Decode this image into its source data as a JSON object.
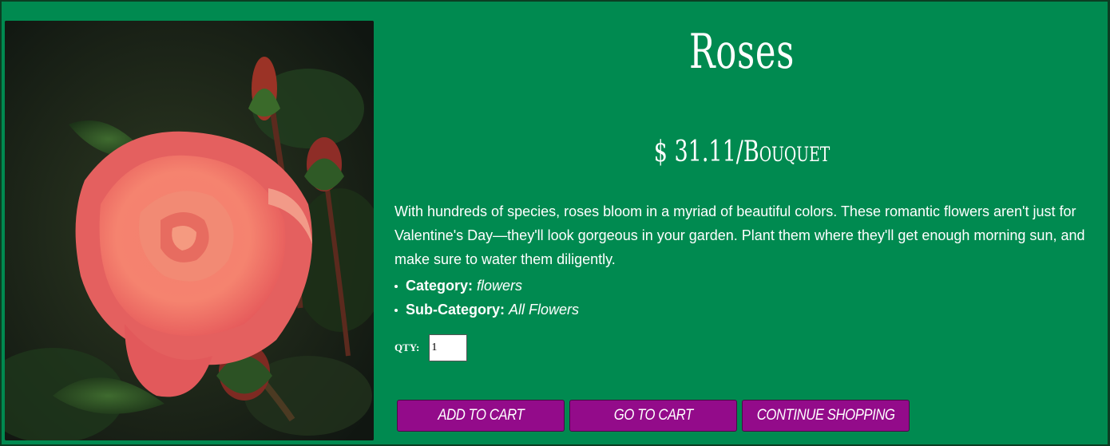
{
  "product": {
    "title": "Roses",
    "price": "$ 31.11/Bouquet",
    "description": "With hundreds of species, roses bloom in a myriad of beautiful colors. These romantic flowers aren't just for Valentine's Day—they'll look gorgeous in your garden. Plant them where they'll get enough morning sun, and make sure to water them diligently.",
    "image_alt": "Pink rose with buds"
  },
  "meta": {
    "category_key": "Category:",
    "category_value": "flowers",
    "subcategory_key": "Sub-Category:",
    "subcategory_value": "All Flowers"
  },
  "quantity": {
    "label": "QTY:",
    "value": "1"
  },
  "actions": {
    "add_to_cart": "ADD TO CART",
    "go_to_cart": "GO TO CART",
    "continue_shopping": "CONTINUE SHOPPING"
  },
  "colors": {
    "background": "#008a50",
    "button": "#930b8a",
    "text": "#ffffff"
  }
}
